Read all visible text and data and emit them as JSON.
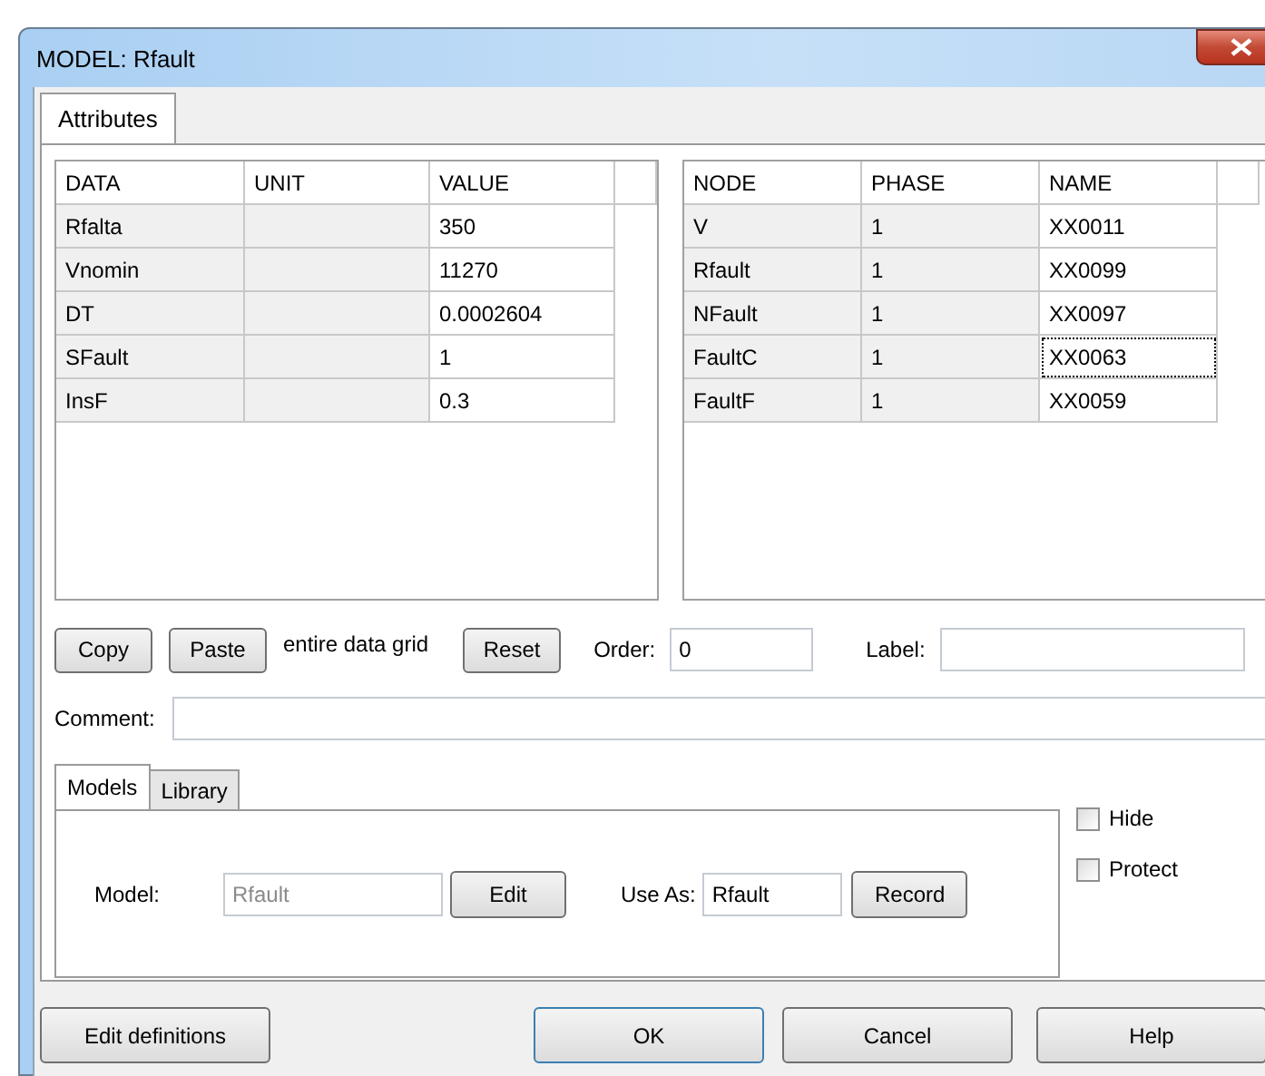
{
  "window": {
    "title": "MODEL: Rfault"
  },
  "tabs": [
    {
      "label": "Attributes",
      "selected": true
    }
  ],
  "data_grid": {
    "columns": [
      "DATA",
      "UNIT",
      "VALUE"
    ],
    "rows": [
      {
        "data": "Rfalta",
        "unit": "",
        "value": "350"
      },
      {
        "data": "Vnomin",
        "unit": "",
        "value": "11270"
      },
      {
        "data": "DT",
        "unit": "",
        "value": "0.0002604"
      },
      {
        "data": "SFault",
        "unit": "",
        "value": "1"
      },
      {
        "data": "InsF",
        "unit": "",
        "value": "0.3"
      }
    ]
  },
  "node_grid": {
    "columns": [
      "NODE",
      "PHASE",
      "NAME"
    ],
    "rows": [
      {
        "node": "V",
        "phase": "1",
        "name": "XX0011",
        "focused": false
      },
      {
        "node": "Rfault",
        "phase": "1",
        "name": "XX0099",
        "focused": false
      },
      {
        "node": "NFault",
        "phase": "1",
        "name": "XX0097",
        "focused": false
      },
      {
        "node": "FaultC",
        "phase": "1",
        "name": "XX0063",
        "focused": true
      },
      {
        "node": "FaultF",
        "phase": "1",
        "name": "XX0059",
        "focused": false
      }
    ]
  },
  "grid_buttons": {
    "copy": "Copy",
    "paste": "Paste",
    "note": "entire data grid",
    "reset": "Reset"
  },
  "order": {
    "label": "Order:",
    "value": "0"
  },
  "label_field": {
    "label": "Label:"
  },
  "comment": {
    "label": "Comment:"
  },
  "inner_tabs": [
    {
      "label": "Models",
      "selected": true
    },
    {
      "label": "Library",
      "selected": false
    }
  ],
  "model": {
    "label": "Model:",
    "value": "Rfault",
    "disabled": true,
    "edit": "Edit",
    "use_as_label": "Use As:",
    "use_as_value": "Rfault",
    "record": "Record"
  },
  "options": [
    {
      "label": "Hide",
      "checked": false
    },
    {
      "label": "Protect",
      "checked": false
    }
  ],
  "footer": [
    "Edit definitions",
    "OK",
    "Cancel",
    "Help"
  ]
}
